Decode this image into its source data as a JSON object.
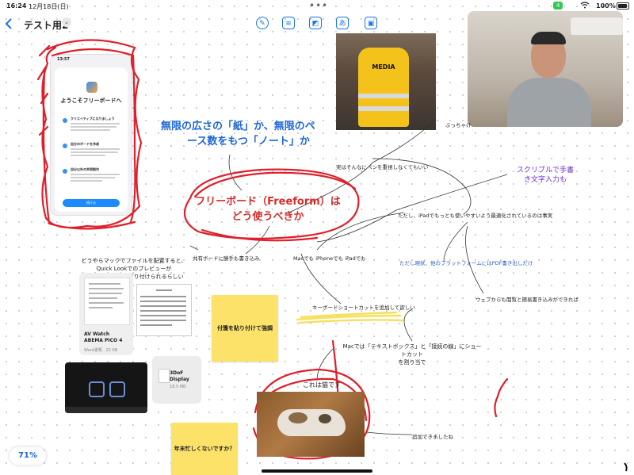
{
  "status": {
    "time": "16:24",
    "date": "12月18日(日)",
    "dots": "•••",
    "battery_badge": "4",
    "battery_pct": "100%"
  },
  "toolbar": {
    "title": "テスト用2"
  },
  "phone": {
    "time": "13:57",
    "welcome": "ようこそフリーボードへ",
    "row_titles": [
      "クリエイティブになりましょう",
      "自分のボードを作成",
      "自分以外の共同制作"
    ],
    "button": "続ける"
  },
  "media_photo": {
    "label": "MEDIA"
  },
  "canvas": {
    "blue_heading_1": "無限の広さの「紙」か、無限のペ",
    "blue_heading_2": "ース数をもつ「ノート」か",
    "red_heading_1": "フリーボード（Freeform）は",
    "red_heading_2": "どう使うべきか",
    "note_bucchake": "ぶっちゃけ",
    "note_pen": "実はそんなにペンを重視しなくてもいい",
    "note_scribble_1": "スクリブルで手書",
    "note_scribble_2": "き文字入力も",
    "note_ipad_opt": "ただし、iPadでもっとも使いやすいよう最適化されているのは事実",
    "note_shared": "共有ボードに勝手も書き込み",
    "note_mac_iphone": "Macでも iPhoneでも iPadでも",
    "note_pdf": "ただし現状、他のプラットフォームにはPDF書き出しだけ",
    "note_quicklook_1": "どうやらマックでファイルを配置すると、",
    "note_quicklook_2": "Quick Lookでのプレビューが",
    "note_quicklook_3": "アイコンになって貼り付けられるらしい",
    "note_web": "ウェブからも閲覧と簡易書き込みができれば",
    "note_shortcut": "キーボードショートカットを追加して欲しい",
    "note_mac_textbox_1": "Macでは「テキストボックス」と「接続の線」にショートカット",
    "note_mac_textbox_2": "を割り当て",
    "note_cat": "これは猫です",
    "note_added": "追加できましたね"
  },
  "file_card": {
    "name_1": "AV Watch",
    "name_2": "ABEMA PICO 4",
    "meta": "Word書類 · 22 KB"
  },
  "file_3dof": {
    "name_1": "3DoF",
    "name_2": "Display",
    "size": "18.5 MB"
  },
  "stickies": {
    "sticky_1": "付箋を貼り付けて強調",
    "sticky_2": "年末忙しくないですか？"
  },
  "zoom": {
    "level": "71%"
  },
  "colors": {
    "accent_blue": "#1a73e8",
    "ink_red": "#e01f2a",
    "ink_blue": "#1a66d9",
    "sticky_yellow": "#fde26a",
    "ink_purple": "#6a2fd6"
  }
}
